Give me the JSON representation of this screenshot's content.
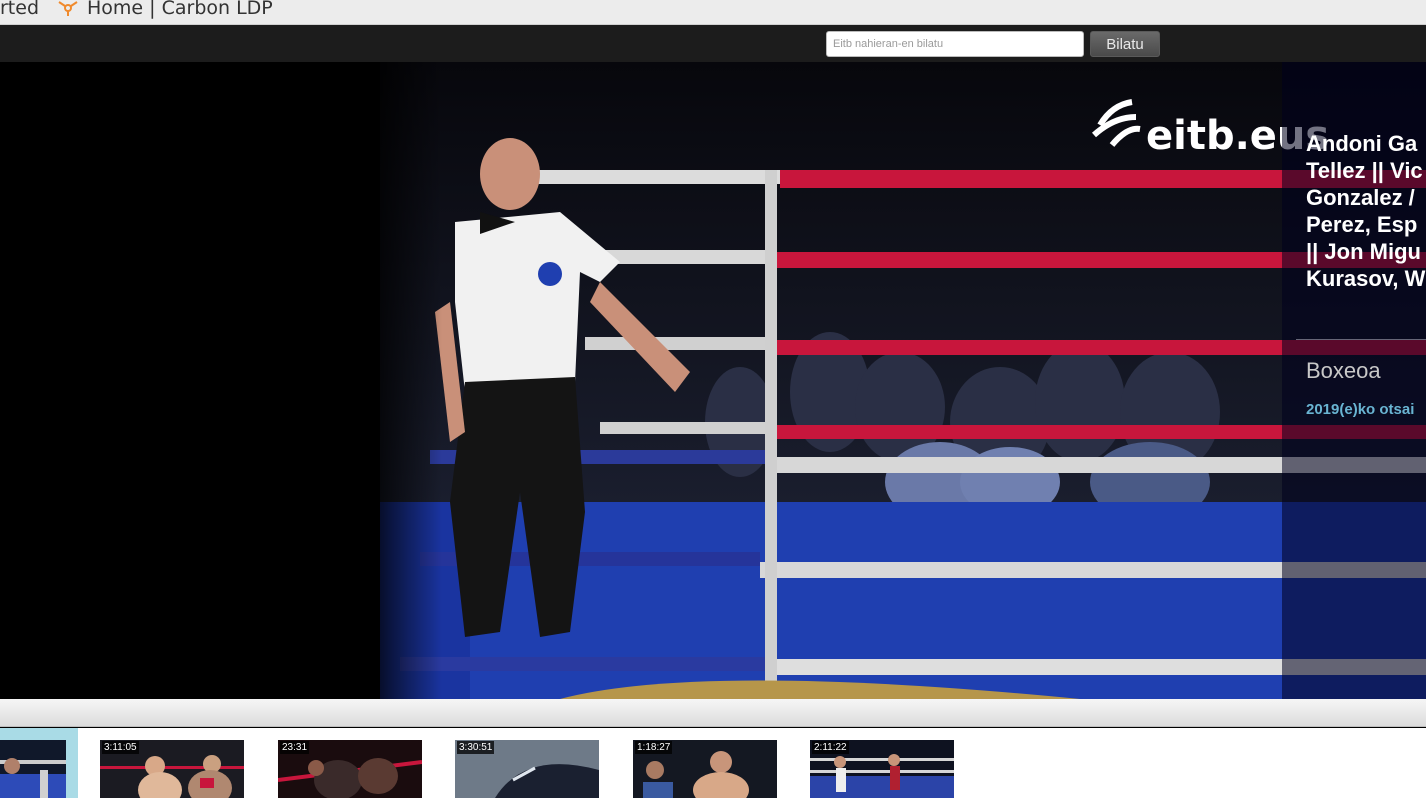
{
  "bookmarks": {
    "truncated_label": "rted",
    "home_label": "Home | Carbon LDP"
  },
  "header": {
    "search_placeholder": "Eitb nahieran-en bilatu",
    "search_button": "Bilatu"
  },
  "player": {
    "watermark": "eitb.eus",
    "info": {
      "title": "Andoni Ga\nTellez || Vic\nGonzalez /\nPerez, Esp\n|| Jon Migu\nKurasov, W",
      "category": "Boxeoa",
      "date": "2019(e)ko otsai"
    }
  },
  "thumbnails": [
    {
      "duration": ""
    },
    {
      "duration": "3:11:05"
    },
    {
      "duration": "23:31"
    },
    {
      "duration": "3:30:51"
    },
    {
      "duration": "1:18:27"
    },
    {
      "duration": "2:11:22"
    }
  ],
  "colors": {
    "header_bg": "#1c1c1c",
    "ring_blue": "#1f3fb0",
    "rope_red": "#c8163c",
    "date_blue": "#69b4d2",
    "active_thumb": "#a9dbe6"
  }
}
